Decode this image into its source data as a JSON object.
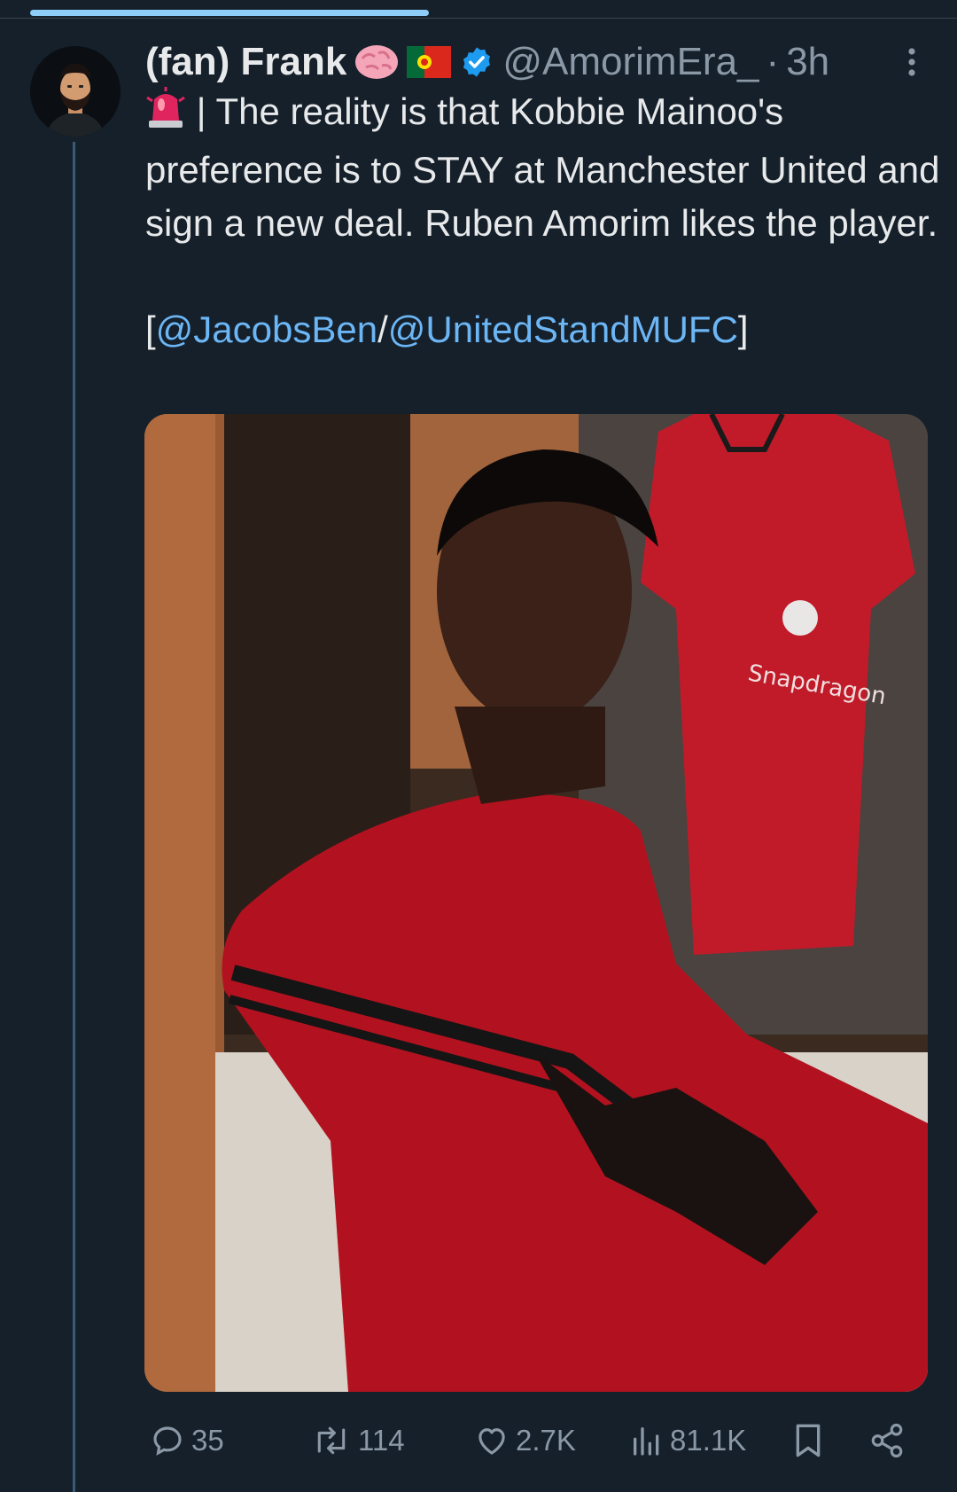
{
  "tweet": {
    "display_name": "(fan) Frank",
    "handle": "@AmorimEra_",
    "separator": "·",
    "time": "3h",
    "text_prefix": " | The reality is that Kobbie Mainoo's preference is to STAY at Manchester United and sign a new deal. Ruben Amorim likes the player.\n\n[",
    "mention_1": "@JacobsBen",
    "mention_sep": "/",
    "mention_2": "@UnitedStandMUFC",
    "text_suffix": "]",
    "image_alt": "Kobbie Mainoo in Manchester United kit"
  },
  "stats": {
    "replies": "35",
    "reposts": "114",
    "likes": "2.7K",
    "views": "81.1K"
  },
  "colors": {
    "background": "#15202b",
    "text": "#e7e9ea",
    "muted": "#8b98a5",
    "link": "#6cb6f5",
    "verified": "#1d9bf0",
    "thread_line": "#3b5a78"
  },
  "icons": {
    "avatar": "avatar-bearded-man",
    "emoji_1": "brain-emoji",
    "emoji_2": "portugal-flag-emoji",
    "verified": "verified-badge-icon",
    "siren": "siren-emoji",
    "more": "more-options-icon",
    "reply": "reply-icon",
    "repost": "repost-icon",
    "like": "like-icon",
    "views": "views-icon",
    "bookmark": "bookmark-icon",
    "share": "share-icon"
  }
}
